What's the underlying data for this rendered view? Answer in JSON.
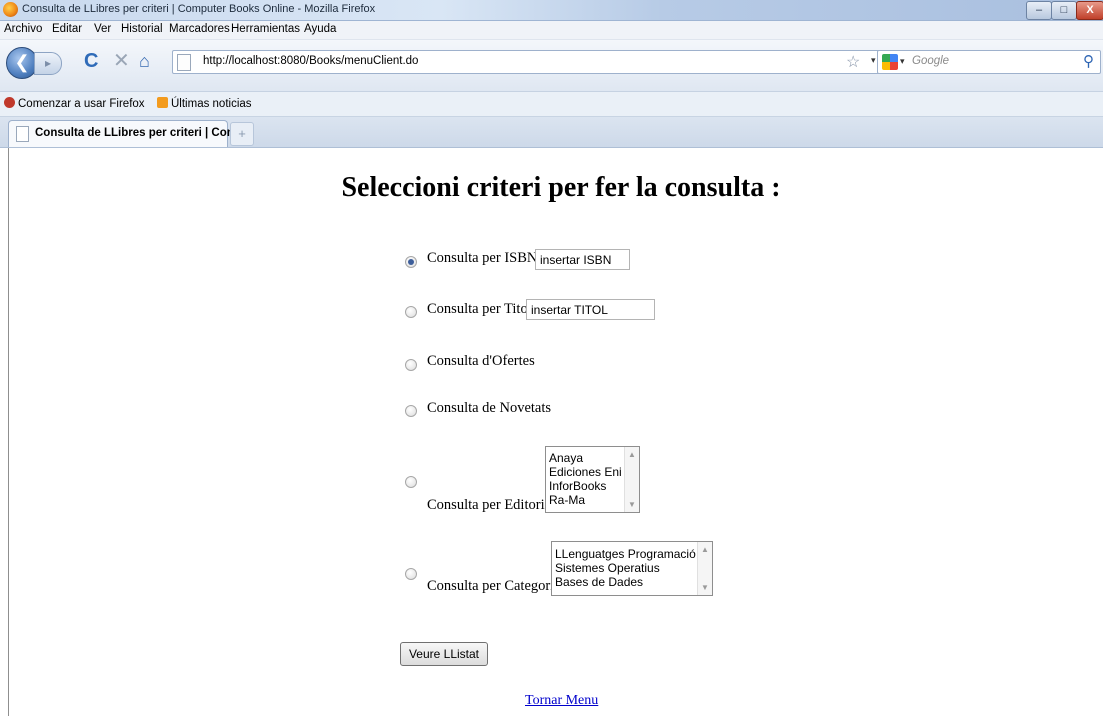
{
  "window": {
    "title": "Consulta de LLibres per criteri | Computer Books Online - Mozilla Firefox",
    "min_glyph": "–",
    "max_glyph": "□",
    "close_glyph": "X"
  },
  "menu": {
    "items": [
      "Archivo",
      "Editar",
      "Ver",
      "Historial",
      "Marcadores",
      "Herramientas",
      "Ayuda"
    ]
  },
  "nav": {
    "url": "http://localhost:8080/Books/menuClient.do",
    "search_engine": "Google",
    "back_glyph": "❮",
    "forward_glyph": "▸",
    "reload_glyph": "C",
    "stop_glyph": "✕",
    "home_glyph": "⌂",
    "star_glyph": "☆",
    "drop_glyph": "▾",
    "search_glyph": "⚲"
  },
  "bookmarks": {
    "items": [
      "Comenzar a usar Firefox",
      "Últimas noticias"
    ]
  },
  "tabs": {
    "active_title": "Consulta de LLibres per criteri | Comp...",
    "new_tab_glyph": "+"
  },
  "page": {
    "heading": "Seleccioni criteri per fer la consulta :",
    "options": {
      "isbn": {
        "label": "Consulta per ISBN:",
        "value": "insertar ISBN",
        "checked": true
      },
      "titol": {
        "label": "Consulta per Titol:",
        "value": "insertar TITOL",
        "checked": false
      },
      "ofertes": {
        "label": "Consulta d'Ofertes",
        "checked": false
      },
      "novetats": {
        "label": "Consulta de Novetats",
        "checked": false
      },
      "editorial": {
        "label": "Consulta per Editorial:",
        "list": [
          "Anaya",
          "Ediciones Eni",
          "InforBooks",
          "Ra-Ma"
        ],
        "checked": false
      },
      "categoria": {
        "label": "Consulta per Categoria:",
        "list": [
          "LLenguatges Programació",
          "Sistemes Operatius",
          "Bases de Dades"
        ],
        "checked": false
      }
    },
    "submit_label": "Veure LListat",
    "back_link": "Tornar Menu"
  }
}
